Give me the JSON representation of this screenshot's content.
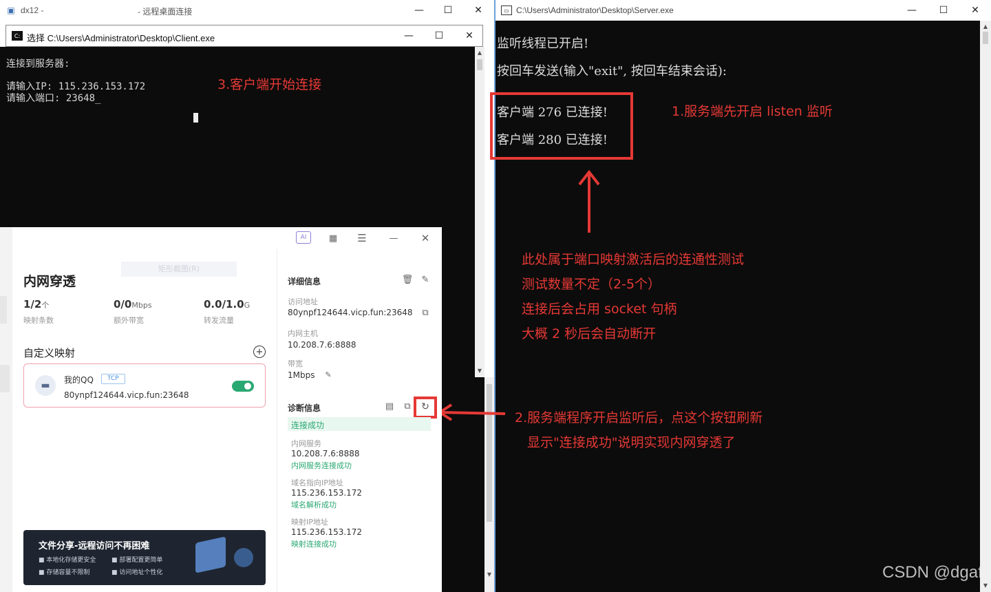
{
  "rdp": {
    "title": "dx12 -",
    "subtitle": "- 远程桌面连接"
  },
  "client": {
    "title": "选择 C:\\Users\\Administrator\\Desktop\\Client.exe",
    "lines": [
      "连接到服务器:",
      "请输入IP: 115.236.153.172",
      "请输入端口: 23648"
    ]
  },
  "server": {
    "title": "C:\\Users\\Administrator\\Desktop\\Server.exe",
    "lines": [
      "监听线程已开启!",
      "按回车发送(输入\"exit\", 按回车结束会话):",
      "客户端 276 已连接!",
      "客户端 280 已连接!"
    ]
  },
  "annotations": {
    "a1": "1.服务端先开启 listen 监听",
    "a3": "3.客户端开始连接",
    "note": [
      "此处属于端口映射激活后的连通性测试",
      "测试数量不定（2-5个）",
      "连接后会占用 socket 句柄",
      "大概 2 秒后会自动断开"
    ],
    "a2": [
      "2.服务端程序开启监听后，点这个按钮刷新",
      "显示\"连接成功\"说明实现内网穿透了"
    ]
  },
  "app": {
    "ghost_button": "矩形截图(R)",
    "title": "内网穿透",
    "stats": [
      {
        "value": "1/2",
        "unit": "个",
        "label": "映射条数"
      },
      {
        "value": "0/0",
        "unit": "Mbps",
        "label": "额外带宽"
      },
      {
        "value": "0.0/1.0",
        "unit": "G",
        "label": "转发流量"
      }
    ],
    "custom_mapping": "自定义映射",
    "mapping": {
      "name": "我的QQ",
      "protocol": "TCP",
      "address": "80ynpf124644.vicp.fun:23648",
      "enabled": true
    },
    "banner": {
      "title": "文件分享-远程访问不再困难",
      "features": [
        "本地化存储更安全",
        "部署配置更简单",
        "存储容量不限制",
        "访问地址个性化"
      ]
    },
    "details": {
      "heading": "详细信息",
      "access_label": "访问地址",
      "access_value": "80ynpf124644.vicp.fun:23648",
      "host_label": "内网主机",
      "host_value": "10.208.7.6:8888",
      "bw_label": "带宽",
      "bw_value": "1Mbps"
    },
    "diag": {
      "heading": "诊断信息",
      "status": "连接成功",
      "items": [
        {
          "label": "内网服务",
          "value": "10.208.7.6:8888",
          "result": "内网服务连接成功"
        },
        {
          "label": "域名指向IP地址",
          "value": "115.236.153.172",
          "result": "域名解析成功"
        },
        {
          "label": "映射IP地址",
          "value": "115.236.153.172",
          "result": "映射连接成功"
        }
      ]
    }
  },
  "watermark": "CSDN @dgaf",
  "colors": {
    "annotation": "#e53935",
    "success": "#2aa872",
    "console_bg": "#0c0c0c"
  }
}
